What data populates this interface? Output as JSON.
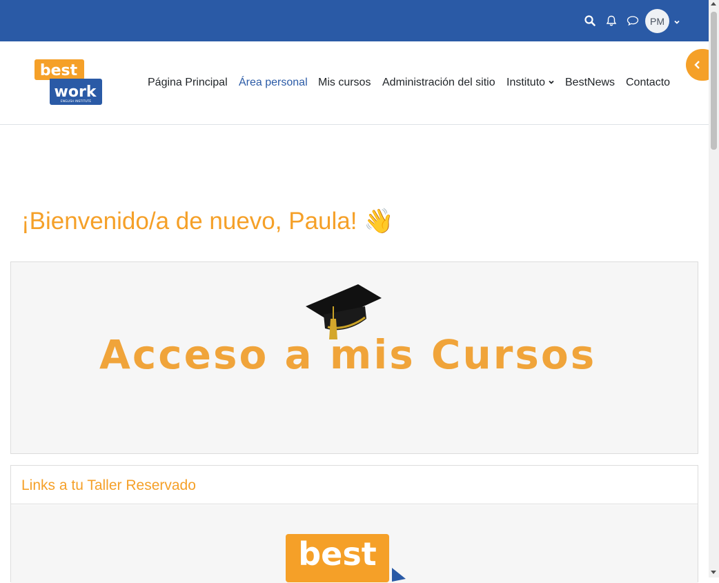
{
  "topbar": {
    "icons": [
      "search-icon",
      "bell-icon",
      "chat-icon"
    ],
    "avatar_initials": "PM",
    "bg_color": "#2a5aa6"
  },
  "nav": {
    "items": [
      {
        "label": "Página Principal",
        "active": false
      },
      {
        "label": "Área personal",
        "active": true
      },
      {
        "label": "Mis cursos",
        "active": false
      },
      {
        "label": "Administración del sitio",
        "active": false
      },
      {
        "label": "Instituto",
        "active": false,
        "has_dropdown": true
      },
      {
        "label": "BestNews",
        "active": false
      },
      {
        "label": "Contacto",
        "active": false
      }
    ]
  },
  "logo": {
    "line1": "best",
    "line2": "work",
    "tagline": "ENGLISH INSTITUTE"
  },
  "welcome": {
    "text": "¡Bienvenido/a de nuevo, Paula! 👋"
  },
  "banner": {
    "text": "Acceso a mis Cursos"
  },
  "workshop": {
    "title": "Links a tu Taller Reservado",
    "logo_text": "best"
  },
  "colors": {
    "accent": "#f5a028",
    "brand_blue": "#2a5aa6",
    "card_bg": "#f6f6f6"
  }
}
